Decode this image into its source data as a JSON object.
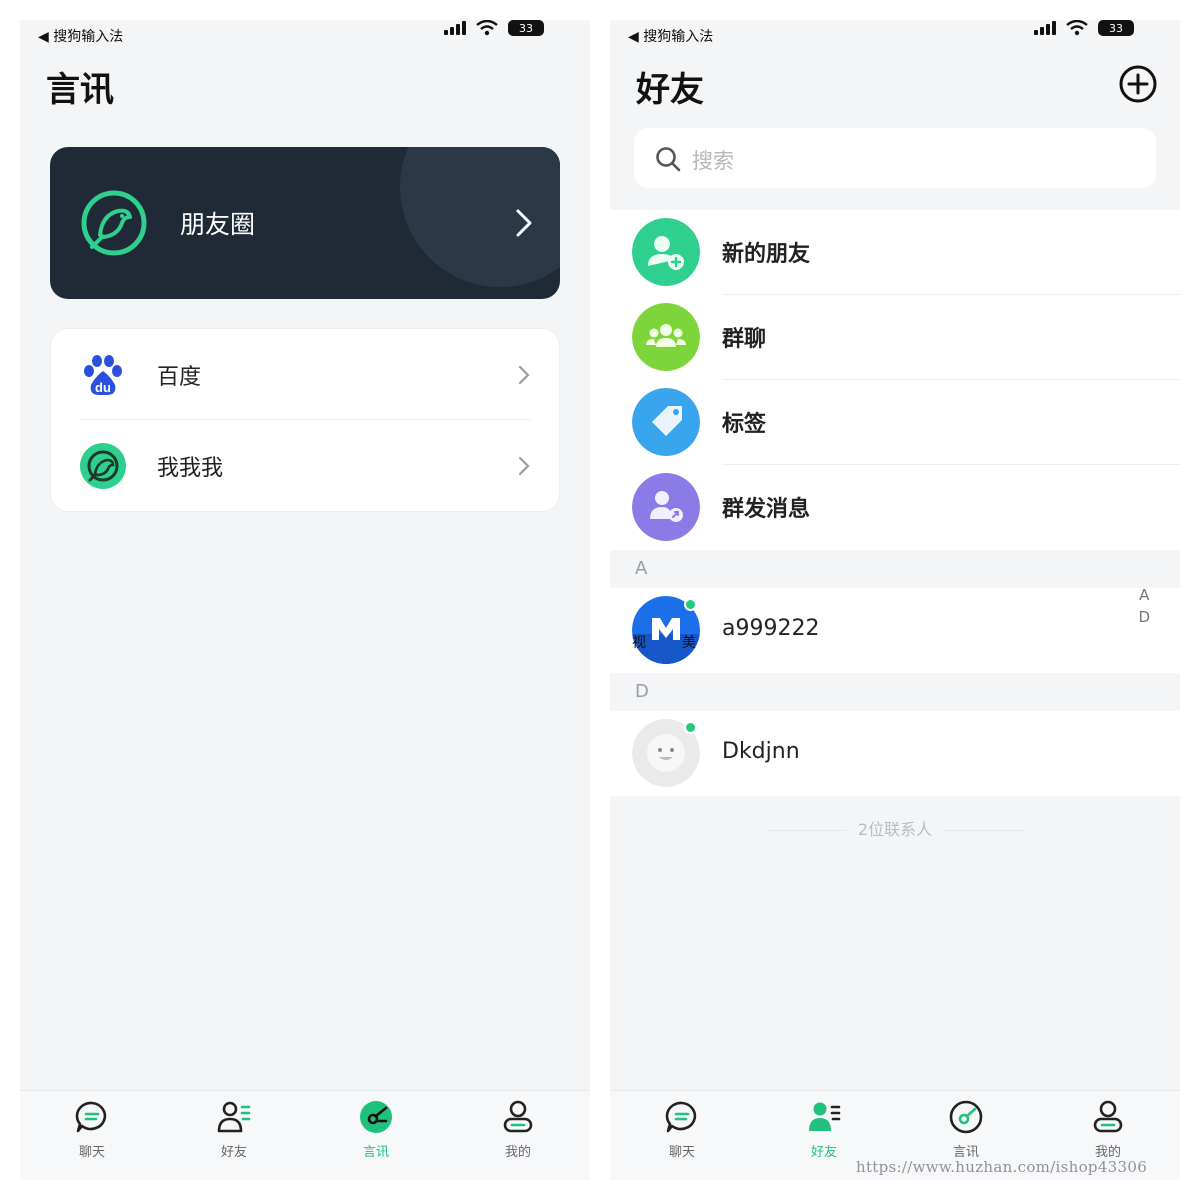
{
  "status_bar": {
    "back_label": "◀ 搜狗输入法",
    "battery": "33"
  },
  "left_screen": {
    "title": "言讯",
    "moments": {
      "label": "朋友圈"
    },
    "items": [
      {
        "label": "百度",
        "icon": "baidu-paw-icon"
      },
      {
        "label": "我我我",
        "icon": "bird-icon"
      }
    ]
  },
  "right_screen": {
    "title": "好友",
    "search": {
      "placeholder": "搜索"
    },
    "functions": [
      {
        "label": "新的朋友",
        "icon": "add-friend-icon",
        "color": "#2fcf8f"
      },
      {
        "label": "群聊",
        "icon": "group-icon",
        "color": "#7ed43b"
      },
      {
        "label": "标签",
        "icon": "tag-icon",
        "color": "#3aa5ef"
      },
      {
        "label": "群发消息",
        "icon": "broadcast-icon",
        "color": "#8b7be6"
      }
    ],
    "sections": [
      {
        "letter": "A",
        "contact": {
          "name": "a999222",
          "avatar_text": "视 M 美"
        }
      },
      {
        "letter": "D",
        "contact": {
          "name": "Dkdjnn"
        }
      }
    ],
    "index_letters": [
      "A",
      "D"
    ],
    "contact_count": "2位联系人"
  },
  "tabbar": {
    "tabs": [
      {
        "label": "聊天",
        "icon": "chat-bubble-icon"
      },
      {
        "label": "好友",
        "icon": "friends-icon"
      },
      {
        "label": "言讯",
        "icon": "discover-icon"
      },
      {
        "label": "我的",
        "icon": "profile-icon"
      }
    ],
    "active_color": "#20c17c"
  },
  "watermark": "https://www.huzhan.com/ishop43306"
}
